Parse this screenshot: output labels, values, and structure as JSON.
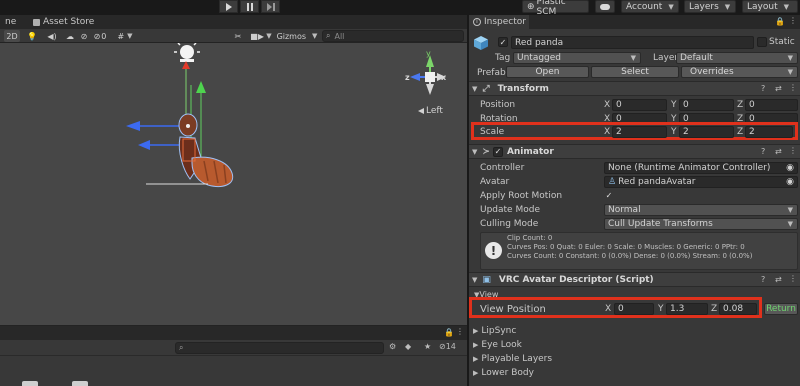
{
  "toolbar": {
    "play_icon": "play-icon",
    "pause_icon": "pause-icon",
    "step_icon": "step-icon",
    "plastic_scm": "Plastic SCM",
    "account": "Account",
    "layers": "Layers",
    "layout": "Layout"
  },
  "scene": {
    "tab_partial": "ne",
    "tab_asset_store": "Asset Store",
    "mode_2d": "2D",
    "hidden_count": "0",
    "gizmos": "Gizmos",
    "search_placeholder": "All",
    "orientation_label": "Left",
    "axis_x": "x",
    "axis_y": "y",
    "axis_z": "z"
  },
  "bottom": {
    "count": "14"
  },
  "inspector": {
    "tab": "Inspector",
    "object_name": "Red panda",
    "static_label": "Static",
    "tag_label": "Tag",
    "tag_value": "Untagged",
    "layer_label": "Layer",
    "layer_value": "Default",
    "prefab_label": "Prefab",
    "open": "Open",
    "select": "Select",
    "overrides": "Overrides",
    "transform": {
      "title": "Transform",
      "position_label": "Position",
      "rotation_label": "Rotation",
      "scale_label": "Scale",
      "position": [
        "0",
        "0",
        "0"
      ],
      "rotation": [
        "0",
        "0",
        "0"
      ],
      "scale": [
        "2",
        "2",
        "2"
      ],
      "x": "X",
      "y": "Y",
      "z": "Z"
    },
    "animator": {
      "title": "Animator",
      "controller_label": "Controller",
      "controller_value": "None (Runtime Animator Controller)",
      "avatar_label": "Avatar",
      "avatar_value": "Red pandaAvatar",
      "apply_root_label": "Apply Root Motion",
      "update_label": "Update Mode",
      "update_value": "Normal",
      "culling_label": "Culling Mode",
      "culling_value": "Cull Update Transforms",
      "info1": "Clip Count: 0",
      "info2": "Curves Pos: 0 Quat: 0 Euler: 0 Scale: 0 Muscles: 0 Generic: 0 PPtr: 0",
      "info3": "Curves Count: 0 Constant: 0 (0.0%) Dense: 0 (0.0%) Stream: 0 (0.0%)"
    },
    "vrc": {
      "title": "VRC Avatar Descriptor (Script)",
      "view_label": "View",
      "view_position_label": "View Position",
      "x": "X",
      "y": "Y",
      "z": "Z",
      "vx": "0",
      "vy": "1.3",
      "vz": "0.08",
      "return": "Return",
      "lipsync": "LipSync",
      "eye_look": "Eye Look",
      "playable_layers": "Playable Layers",
      "lower_body": "Lower Body"
    }
  }
}
